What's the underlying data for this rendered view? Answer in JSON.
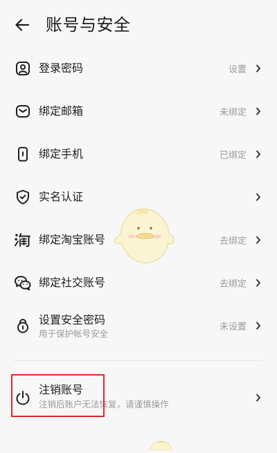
{
  "header": {
    "title": "账号与安全"
  },
  "items": [
    {
      "key": "login-password",
      "icon": "user-badge-icon",
      "label": "登录密码",
      "status": "设置",
      "subtitle": ""
    },
    {
      "key": "bind-email",
      "icon": "mail-icon",
      "label": "绑定邮箱",
      "status": "未绑定",
      "subtitle": ""
    },
    {
      "key": "bind-phone",
      "icon": "phone-icon",
      "label": "绑定手机",
      "status": "已绑定",
      "subtitle": ""
    },
    {
      "key": "real-name",
      "icon": "shield-check-icon",
      "label": "实名认证",
      "status": "",
      "subtitle": ""
    },
    {
      "key": "bind-taobao",
      "icon": "taobao-icon",
      "label": "绑定淘宝账号",
      "status": "去绑定",
      "subtitle": ""
    },
    {
      "key": "bind-social",
      "icon": "chat-bubbles-icon",
      "label": "绑定社交账号",
      "status": "去绑定",
      "subtitle": ""
    },
    {
      "key": "security-password",
      "icon": "lock-icon",
      "label": "设置安全密码",
      "status": "未设置",
      "subtitle": "用于保护帐号安全"
    }
  ],
  "deactivate": {
    "icon": "power-icon",
    "label": "注销账号",
    "subtitle": "注销后账户无法恢复，请谨慎操作"
  },
  "colors": {
    "background": "#f7f7f7",
    "text": "#1f1f1f",
    "muted": "#9b9b9b",
    "highlight": "#e02828"
  }
}
